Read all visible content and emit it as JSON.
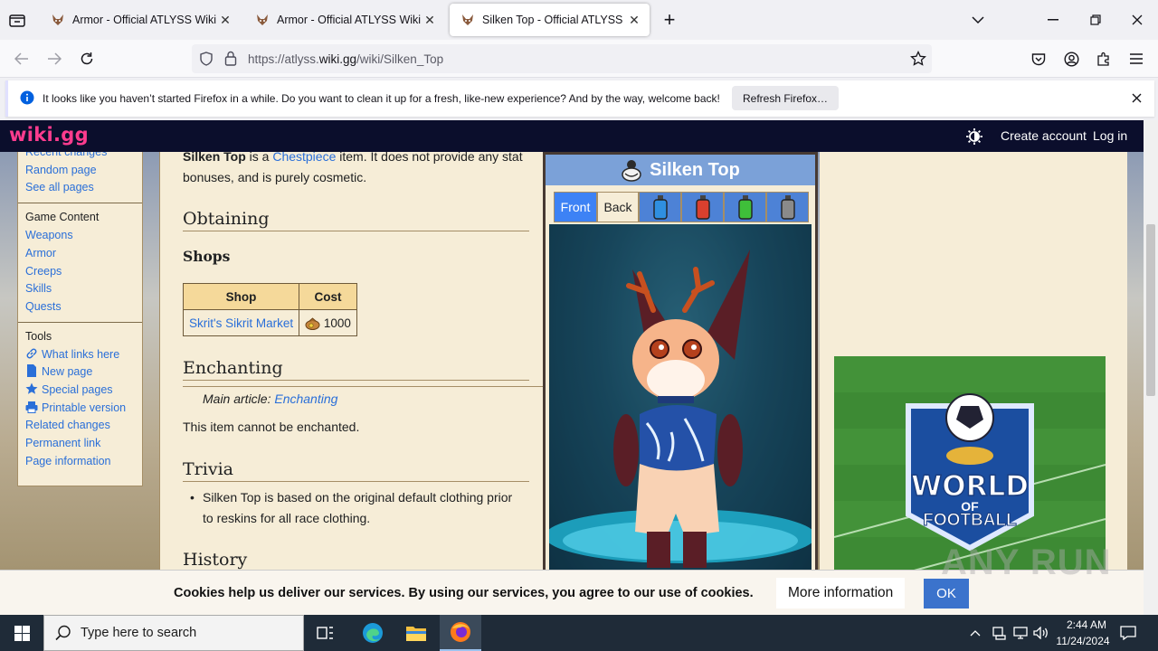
{
  "browser": {
    "tabs": [
      {
        "title": "Armor - Official ATLYSS Wiki",
        "active": false
      },
      {
        "title": "Armor - Official ATLYSS Wiki",
        "active": false
      },
      {
        "title": "Silken Top - Official ATLYSS Wiki",
        "active": true
      }
    ],
    "new_tab": "+",
    "url_prefix": "https://atlyss.",
    "url_domain": "wiki.gg",
    "url_path": "/wiki/Silken_Top",
    "notification": "It looks like you haven’t started Firefox in a while. Do you want to clean it up for a fresh, like-new experience? And by the way, welcome back!",
    "notification_button": "Refresh Firefox…"
  },
  "site": {
    "logo": "wiki.gg",
    "create_account": "Create account",
    "log_in": "Log in"
  },
  "sidebar": {
    "nav_links": [
      "Recent changes",
      "Random page",
      "See all pages"
    ],
    "game_heading": "Game Content",
    "game_links": [
      "Weapons",
      "Armor",
      "Creeps",
      "Skills",
      "Quests"
    ],
    "tools_heading": "Tools",
    "tools_links": [
      {
        "label": "What links here",
        "icon": "link-icon"
      },
      {
        "label": "New page",
        "icon": "page-icon"
      },
      {
        "label": "Special pages",
        "icon": "star-icon"
      },
      {
        "label": "Printable version",
        "icon": "printer-icon"
      },
      {
        "label": "Related changes",
        "icon": ""
      },
      {
        "label": "Permanent link",
        "icon": ""
      },
      {
        "label": "Page information",
        "icon": ""
      }
    ]
  },
  "article": {
    "intro_bold": "Silken Top",
    "intro_1": " is a ",
    "intro_link": "Chestpiece",
    "intro_2": " item. It does not provide any stat bonuses, and is purely cosmetic.",
    "h_obtaining": "Obtaining",
    "h_shops": "Shops",
    "shop_table": {
      "headers": [
        "Shop",
        "Cost"
      ],
      "rows": [
        {
          "shop": "Skrit's Sikrit Market",
          "cost": "1000"
        }
      ]
    },
    "h_enchanting": "Enchanting",
    "main_article_label": "Main article: ",
    "main_article_link": "Enchanting",
    "enchant_text": "This item cannot be enchanted.",
    "h_trivia": "Trivia",
    "trivia_items": [
      "Silken Top is based on the original default clothing prior to reskins for all race clothing."
    ],
    "h_history": "History"
  },
  "infobox": {
    "title": "Silken Top",
    "tabs": [
      "Front",
      "Back"
    ],
    "potion_colors": [
      "#2f8fe0",
      "#d9402e",
      "#3fbf3a",
      "#8a8a8a"
    ]
  },
  "ad": {
    "line1": "WORLD",
    "line2": "OF",
    "line3": "FOOTBALL"
  },
  "cookies": {
    "text": "Cookies help us deliver our services. By using our services, you agree to our use of cookies.",
    "more": "More information",
    "ok": "OK"
  },
  "watermark": "ANY RUN",
  "taskbar": {
    "search_placeholder": "Type here to search",
    "time": "2:44 AM",
    "date": "11/24/2024"
  }
}
